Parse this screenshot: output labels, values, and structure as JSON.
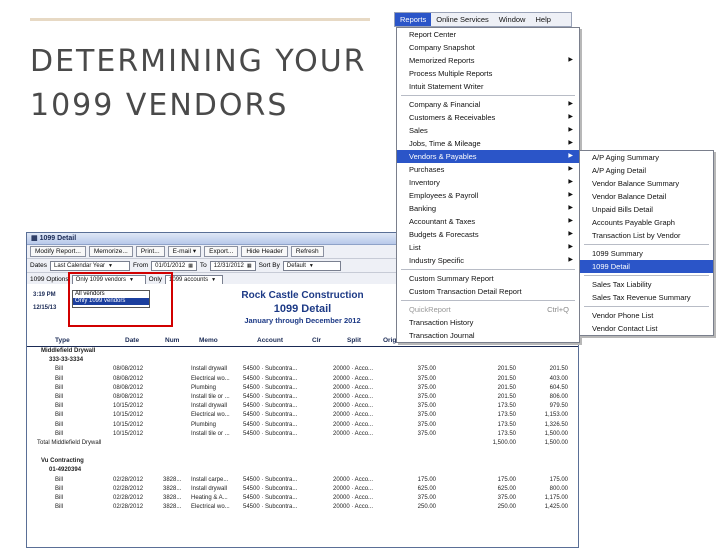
{
  "slide": {
    "title_line1": "DETERMINING YOUR",
    "title_line2": "1099 VENDORS"
  },
  "window": {
    "title": "1099 Detail",
    "toolbar": [
      "Modify Report...",
      "Memorize...",
      "Print...",
      "E-mail ▾",
      "Export...",
      "Hide Header",
      "Refresh"
    ],
    "filters": {
      "dates_label": "Dates",
      "dates_value": "Last Calendar Year",
      "from_label": "From",
      "from_value": "01/01/2012",
      "to_label": "To",
      "to_value": "12/31/2012",
      "sortby_label": "Sort By",
      "sortby_value": "Default",
      "options_label": "1099 Options",
      "options_value": "Only 1099 vendors",
      "only_label": "Only",
      "only_value": "1099 accounts"
    },
    "popup_options": [
      "All vendors",
      "Only 1099 vendors"
    ],
    "stamp_time": "3:19 PM",
    "stamp_date": "12/15/13",
    "company": "Rock Castle Construction",
    "report_title": "1099 Detail",
    "date_range": "January through December 2012",
    "columns": [
      "Type",
      "Date",
      "Num",
      "Memo",
      "Account",
      "Clr",
      "Split",
      "Orig"
    ],
    "rows": [
      {
        "kind": "vendor",
        "text": "Middlefield Drywall"
      },
      {
        "kind": "vendor",
        "text": "333-33-3334"
      },
      {
        "kind": "txn",
        "type": "Bill",
        "date": "08/08/2012",
        "num": "",
        "memo": "Install drywall",
        "acct": "54500 · Subcontra...",
        "split": "20000 · Acco...",
        "orig": "375.00",
        "amt": "201.50",
        "bal": "201.50"
      },
      {
        "kind": "txn",
        "type": "Bill",
        "date": "08/08/2012",
        "num": "",
        "memo": "Electrical wo...",
        "acct": "54500 · Subcontra...",
        "split": "20000 · Acco...",
        "orig": "375.00",
        "amt": "201.50",
        "bal": "403.00"
      },
      {
        "kind": "txn",
        "type": "Bill",
        "date": "08/08/2012",
        "num": "",
        "memo": "Plumbing",
        "acct": "54500 · Subcontra...",
        "split": "20000 · Acco...",
        "orig": "375.00",
        "amt": "201.50",
        "bal": "604.50"
      },
      {
        "kind": "txn",
        "type": "Bill",
        "date": "08/08/2012",
        "num": "",
        "memo": "Install tile or ...",
        "acct": "54500 · Subcontra...",
        "split": "20000 · Acco...",
        "orig": "375.00",
        "amt": "201.50",
        "bal": "806.00"
      },
      {
        "kind": "txn",
        "type": "Bill",
        "date": "10/15/2012",
        "num": "",
        "memo": "Install drywall",
        "acct": "54500 · Subcontra...",
        "split": "20000 · Acco...",
        "orig": "375.00",
        "amt": "173.50",
        "bal": "979.50"
      },
      {
        "kind": "txn",
        "type": "Bill",
        "date": "10/15/2012",
        "num": "",
        "memo": "Electrical wo...",
        "acct": "54500 · Subcontra...",
        "split": "20000 · Acco...",
        "orig": "375.00",
        "amt": "173.50",
        "bal": "1,153.00"
      },
      {
        "kind": "txn",
        "type": "Bill",
        "date": "10/15/2012",
        "num": "",
        "memo": "Plumbing",
        "acct": "54500 · Subcontra...",
        "split": "20000 · Acco...",
        "orig": "375.00",
        "amt": "173.50",
        "bal": "1,326.50"
      },
      {
        "kind": "txn",
        "type": "Bill",
        "date": "10/15/2012",
        "num": "",
        "memo": "Install tile or ...",
        "acct": "54500 · Subcontra...",
        "split": "20000 · Acco...",
        "orig": "375.00",
        "amt": "173.50",
        "bal": "1,500.00"
      },
      {
        "kind": "total",
        "text": "Total Middlefield Drywall",
        "amt": "1,500.00",
        "bal": "1,500.00"
      },
      {
        "kind": "blank"
      },
      {
        "kind": "vendor",
        "text": "Vu Contracting"
      },
      {
        "kind": "vendor",
        "text": "01-4920394"
      },
      {
        "kind": "txn",
        "type": "Bill",
        "date": "02/28/2012",
        "num": "3828...",
        "memo": "Install carpe...",
        "acct": "54500 · Subcontra...",
        "split": "20000 · Acco...",
        "orig": "175.00",
        "amt": "175.00",
        "bal": "175.00"
      },
      {
        "kind": "txn",
        "type": "Bill",
        "date": "02/28/2012",
        "num": "3828...",
        "memo": "Install drywall",
        "acct": "54500 · Subcontra...",
        "split": "20000 · Acco...",
        "orig": "625.00",
        "amt": "625.00",
        "bal": "800.00"
      },
      {
        "kind": "txn",
        "type": "Bill",
        "date": "02/28/2012",
        "num": "3828...",
        "memo": "Heating & A...",
        "acct": "54500 · Subcontra...",
        "split": "20000 · Acco...",
        "orig": "375.00",
        "amt": "375.00",
        "bal": "1,175.00"
      },
      {
        "kind": "txn",
        "type": "Bill",
        "date": "02/28/2012",
        "num": "3828...",
        "memo": "Electrical wo...",
        "acct": "54500 · Subcontra...",
        "split": "20000 · Acco...",
        "orig": "250.00",
        "amt": "250.00",
        "bal": "1,425.00"
      }
    ]
  },
  "menubar": [
    "Reports",
    "Online Services",
    "Window",
    "Help"
  ],
  "reports_menu": [
    {
      "label": "Report Center"
    },
    {
      "label": "Company Snapshot"
    },
    {
      "label": "Memorized Reports",
      "sub": "▶"
    },
    {
      "label": "Process Multiple Reports"
    },
    {
      "label": "Intuit Statement Writer"
    },
    {
      "sep": true
    },
    {
      "label": "Company & Financial",
      "sub": "▶"
    },
    {
      "label": "Customers & Receivables",
      "sub": "▶"
    },
    {
      "label": "Sales",
      "sub": "▶"
    },
    {
      "label": "Jobs, Time & Mileage",
      "sub": "▶"
    },
    {
      "label": "Vendors & Payables",
      "sub": "▶",
      "hl": true
    },
    {
      "label": "Purchases",
      "sub": "▶"
    },
    {
      "label": "Inventory",
      "sub": "▶"
    },
    {
      "label": "Employees & Payroll",
      "sub": "▶"
    },
    {
      "label": "Banking",
      "sub": "▶"
    },
    {
      "label": "Accountant & Taxes",
      "sub": "▶"
    },
    {
      "label": "Budgets & Forecasts",
      "sub": "▶"
    },
    {
      "label": "List",
      "sub": "▶"
    },
    {
      "label": "Industry Specific",
      "sub": "▶"
    },
    {
      "sep": true
    },
    {
      "label": "Custom Summary Report"
    },
    {
      "label": "Custom Transaction Detail Report"
    },
    {
      "sep": true
    },
    {
      "label": "QuickReport",
      "sc": "Ctrl+Q",
      "dis": true
    },
    {
      "label": "Transaction History"
    },
    {
      "label": "Transaction Journal"
    }
  ],
  "vendors_submenu": [
    {
      "label": "A/P Aging Summary"
    },
    {
      "label": "A/P Aging Detail"
    },
    {
      "label": "Vendor Balance Summary"
    },
    {
      "label": "Vendor Balance Detail"
    },
    {
      "label": "Unpaid Bills Detail"
    },
    {
      "label": "Accounts Payable Graph"
    },
    {
      "label": "Transaction List by Vendor"
    },
    {
      "sep": true
    },
    {
      "label": "1099 Summary"
    },
    {
      "label": "1099 Detail",
      "hl": true
    },
    {
      "sep": true
    },
    {
      "label": "Sales Tax Liability"
    },
    {
      "label": "Sales Tax Revenue Summary"
    },
    {
      "sep": true
    },
    {
      "label": "Vendor Phone List"
    },
    {
      "label": "Vendor Contact List"
    }
  ]
}
